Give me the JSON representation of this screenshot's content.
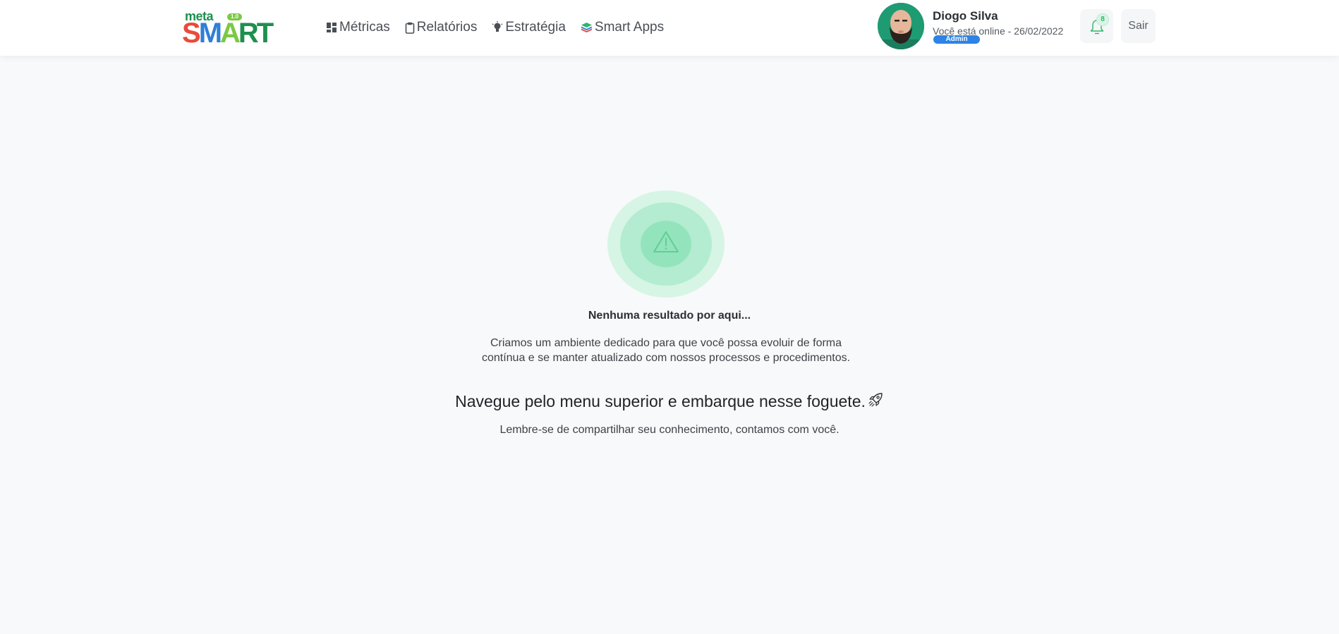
{
  "brand": {
    "prefix": "meta",
    "name_letters": [
      "S",
      "M",
      "A",
      "R",
      "T"
    ],
    "version": "1.0",
    "colors": [
      "#e94b3c",
      "#2f7fd6",
      "#7ac943",
      "#1e8f4e"
    ]
  },
  "nav": {
    "items": [
      {
        "label": "Métricas",
        "icon": "dashboard-icon"
      },
      {
        "label": "Relatórios",
        "icon": "clipboard-icon"
      },
      {
        "label": "Estratégia",
        "icon": "lightbulb-icon"
      },
      {
        "label": "Smart Apps",
        "icon": "layers-icon"
      }
    ]
  },
  "user": {
    "name": "Diogo Silva",
    "status": "Você está online - 26/02/2022",
    "role": "Admin"
  },
  "notifications": {
    "count": "8",
    "icon": "bell-icon"
  },
  "logout": {
    "label": "Sair"
  },
  "empty_state": {
    "icon": "warning-icon",
    "title": "Nenhuma resultado por aqui...",
    "description": "Criamos um ambiente dedicado para que você possa evoluir de forma contínua e se manter atualizado com nossos processos e procedimentos.",
    "heading": "Navegue pelo menu superior e embarque nesse foguete.",
    "note": "Lembre-se de compartilhar seu conhecimento, contamos com você."
  },
  "colors": {
    "accent_green": "#2fb56a",
    "badge_blue": "#2d83e6",
    "page_background": "#f8f9fb"
  }
}
